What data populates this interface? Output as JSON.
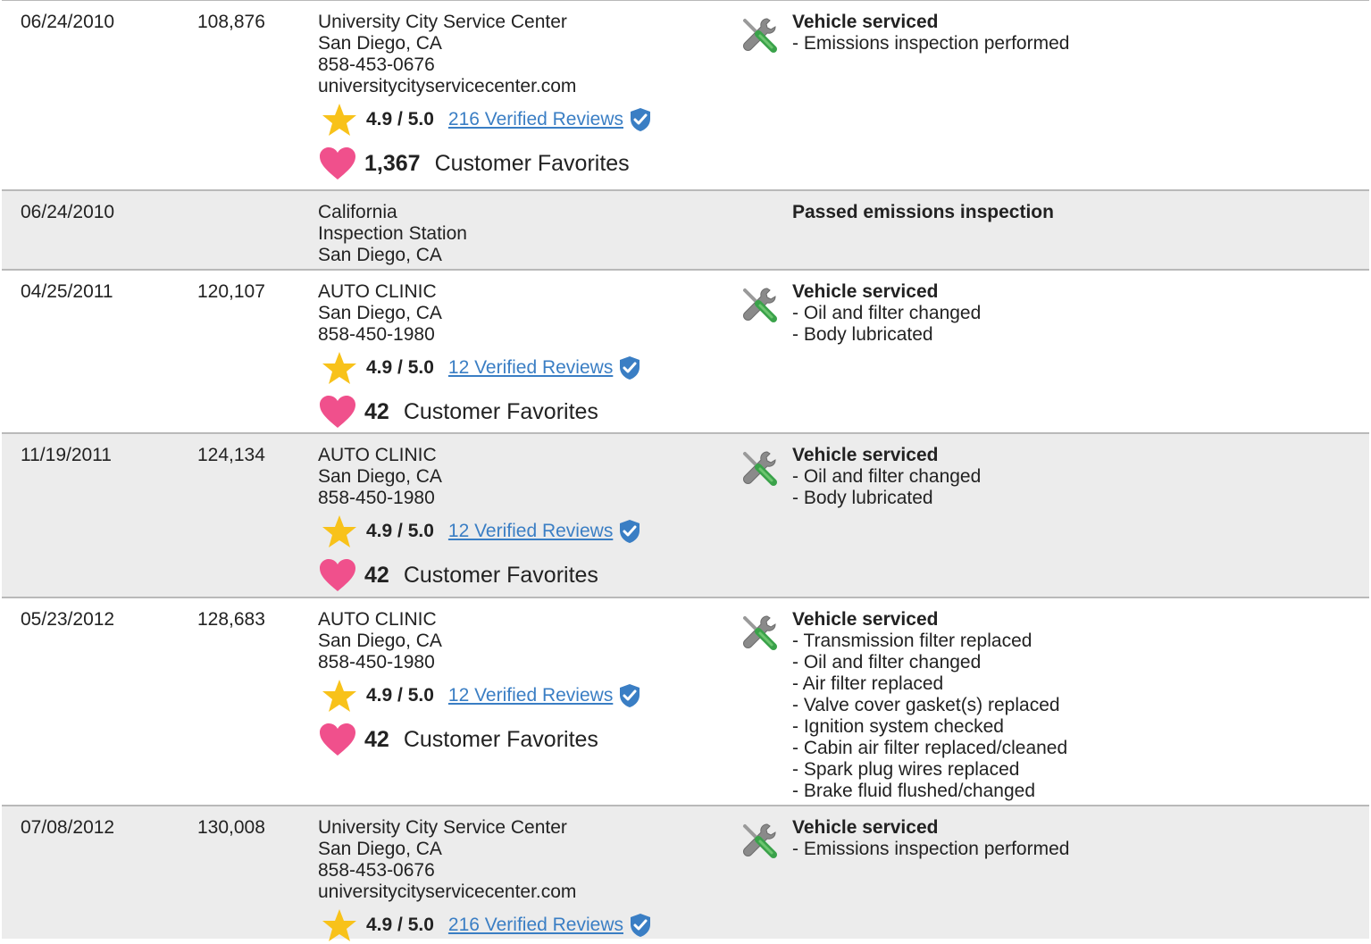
{
  "records": [
    {
      "date": "06/24/2010",
      "odometer": "108,876",
      "source_lines": [
        "University City Service Center",
        "San Diego, CA",
        "858-453-0676",
        "universitycityservicecenter.com"
      ],
      "rating": "4.9 / 5.0",
      "reviews": "216 Verified Reviews",
      "favorites_count": "1,367",
      "favorites_label": "Customer Favorites",
      "service_title": "Vehicle serviced",
      "service_items": [
        "- Emissions inspection performed"
      ],
      "has_icon": true
    },
    {
      "date": "06/24/2010",
      "odometer": "",
      "source_lines": [
        "California",
        "Inspection Station",
        "San Diego, CA"
      ],
      "service_title": "Passed emissions inspection",
      "service_items": [],
      "has_icon": false
    },
    {
      "date": "04/25/2011",
      "odometer": "120,107",
      "source_lines": [
        "AUTO CLINIC",
        "San Diego, CA",
        "858-450-1980"
      ],
      "rating": "4.9 / 5.0",
      "reviews": "12 Verified Reviews",
      "favorites_count": "42",
      "favorites_label": "Customer Favorites",
      "service_title": "Vehicle serviced",
      "service_items": [
        "- Oil and filter changed",
        "- Body lubricated"
      ],
      "has_icon": true
    },
    {
      "date": "11/19/2011",
      "odometer": "124,134",
      "source_lines": [
        "AUTO CLINIC",
        "San Diego, CA",
        "858-450-1980"
      ],
      "rating": "4.9 / 5.0",
      "reviews": "12 Verified Reviews",
      "favorites_count": "42",
      "favorites_label": "Customer Favorites",
      "service_title": "Vehicle serviced",
      "service_items": [
        "- Oil and filter changed",
        "- Body lubricated"
      ],
      "has_icon": true
    },
    {
      "date": "05/23/2012",
      "odometer": "128,683",
      "source_lines": [
        "AUTO CLINIC",
        "San Diego, CA",
        "858-450-1980"
      ],
      "rating": "4.9 / 5.0",
      "reviews": "12 Verified Reviews",
      "favorites_count": "42",
      "favorites_label": "Customer Favorites",
      "service_title": "Vehicle serviced",
      "service_items": [
        "- Transmission filter replaced",
        "- Oil and filter changed",
        "- Air filter replaced",
        "- Valve cover gasket(s) replaced",
        "- Ignition system checked",
        "- Cabin air filter replaced/cleaned",
        "- Spark plug wires replaced",
        "- Brake fluid flushed/changed"
      ],
      "has_icon": true
    },
    {
      "date": "07/08/2012",
      "odometer": "130,008",
      "source_lines": [
        "University City Service Center",
        "San Diego, CA",
        "858-453-0676",
        "universitycityservicecenter.com"
      ],
      "rating": "4.9 / 5.0",
      "reviews": "216 Verified Reviews",
      "service_title": "Vehicle serviced",
      "service_items": [
        "- Emissions inspection performed"
      ],
      "has_icon": true
    }
  ],
  "icons": {
    "service": "wrench-screwdriver-icon",
    "rating": "star-icon",
    "verified": "verified-shield-icon",
    "favorite": "heart-icon"
  },
  "colors": {
    "star": "#f8c21a",
    "heart": "#f0508c",
    "link": "#3a7ec4",
    "shield": "#3a7ec4",
    "alt_row": "#ececec",
    "wrench_green": "#3aa24a"
  }
}
